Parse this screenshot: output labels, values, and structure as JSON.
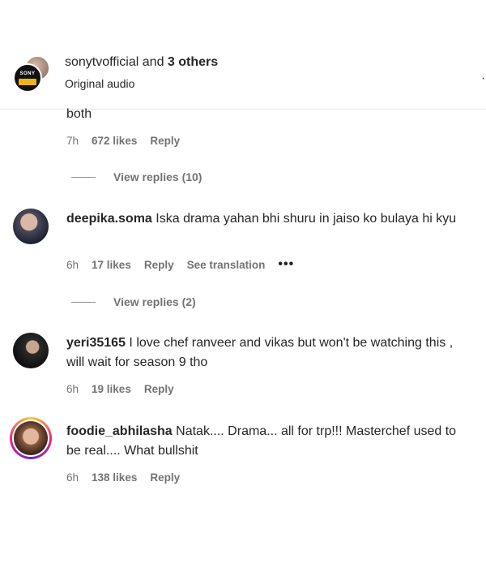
{
  "header": {
    "account": "sonytvofficial",
    "and_text": "and",
    "others": "3 others",
    "subtitle": "Original audio",
    "edge_mark": "·",
    "logo_text": "SONY"
  },
  "comments": [
    {
      "text": "both",
      "time": "7h",
      "likes": "672 likes",
      "reply": "Reply",
      "view_replies": "View replies (10)"
    },
    {
      "username": "deepika.soma",
      "text": "Iska drama yahan bhi shuru in jaiso ko bulaya hi kyu",
      "time": "6h",
      "likes": "17 likes",
      "reply": "Reply",
      "translation": "See translation",
      "more": "•••",
      "view_replies": "View replies (2)"
    },
    {
      "username": "yeri35165",
      "text": "I love chef ranveer and vikas but won't be watching this , will wait for season 9 tho",
      "time": "6h",
      "likes": "19 likes",
      "reply": "Reply"
    },
    {
      "username": "foodie_abhilasha",
      "text": "Natak.... Drama... all for trp!!! Masterchef used to be real.... What bullshit",
      "time": "6h",
      "likes": "138 likes",
      "reply": "Reply"
    }
  ]
}
